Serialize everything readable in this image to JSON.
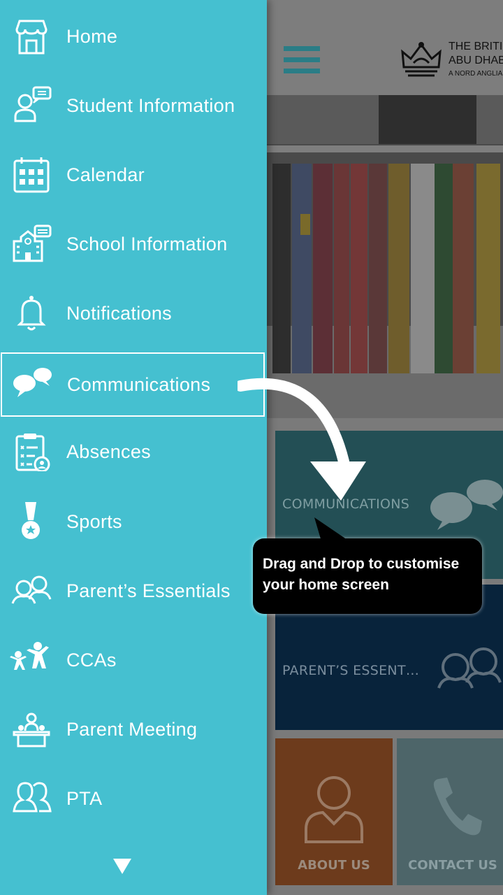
{
  "background": {
    "header": {
      "logo_line1": "THE BRITISH",
      "logo_line2": "ABU DHAB",
      "logo_line3": "A NORD ANGLIA"
    },
    "tiles": {
      "communications": "COMMUNICATIONS",
      "parents_essentials": "PARENT’S ESSENT…",
      "about_us": "ABOUT US",
      "contact_us": "CONTACT US"
    }
  },
  "drawer": {
    "items": [
      {
        "label": "Home",
        "icon": "home-icon"
      },
      {
        "label": "Student Information",
        "icon": "student-info-icon"
      },
      {
        "label": "Calendar",
        "icon": "calendar-icon"
      },
      {
        "label": "School Information",
        "icon": "school-info-icon"
      },
      {
        "label": "Notifications",
        "icon": "bell-icon"
      },
      {
        "label": "Communications",
        "icon": "chat-bubbles-icon"
      },
      {
        "label": "Absences",
        "icon": "clipboard-icon"
      },
      {
        "label": "Sports",
        "icon": "medal-icon"
      },
      {
        "label": "Parent’s Essentials",
        "icon": "parents-icon"
      },
      {
        "label": "CCAs",
        "icon": "activity-people-icon"
      },
      {
        "label": "Parent Meeting",
        "icon": "meeting-icon"
      },
      {
        "label": "PTA",
        "icon": "group-icon"
      }
    ],
    "selected_index": 5
  },
  "tutorial": {
    "tooltip_text": "Drag and Drop to customise your home screen"
  },
  "colors": {
    "drawer_bg": "#45c0d0",
    "accent": "#2a7d86"
  }
}
